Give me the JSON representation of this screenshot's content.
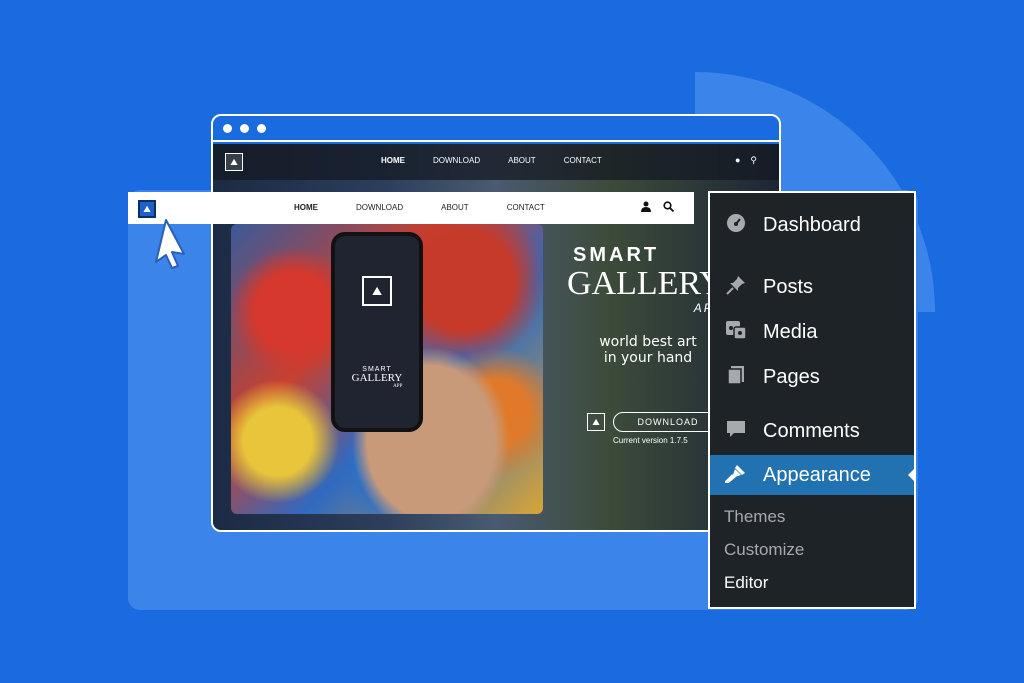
{
  "colors": {
    "background": "#1a6be0",
    "panel": "#3b84ea",
    "wp_menu_bg": "#1d2327",
    "wp_active": "#2271b1"
  },
  "site": {
    "nav": {
      "links": [
        "HOME",
        "DOWNLOAD",
        "ABOUT",
        "CONTACT"
      ],
      "icons": [
        "user-icon",
        "search-icon"
      ]
    },
    "hero": {
      "brand_smart": "SMART",
      "brand_gallery": "GALLERY",
      "brand_app": "APP",
      "tagline": "world best art in your hand",
      "download_label": "DOWNLOAD",
      "version": "Current version 1.7.5"
    },
    "phone": {
      "brand_smart": "SMART",
      "brand_gallery": "GALLERY",
      "brand_app": "APP"
    }
  },
  "wp_menu": {
    "items": [
      {
        "label": "Dashboard",
        "icon": "dashboard-icon"
      },
      {
        "label": "Posts",
        "icon": "pin-icon"
      },
      {
        "label": "Media",
        "icon": "media-icon"
      },
      {
        "label": "Pages",
        "icon": "pages-icon"
      },
      {
        "label": "Comments",
        "icon": "comment-icon"
      },
      {
        "label": "Appearance",
        "icon": "brush-icon",
        "active": true
      }
    ],
    "submenu": [
      {
        "label": "Themes"
      },
      {
        "label": "Customize"
      },
      {
        "label": "Editor",
        "current": true
      }
    ]
  }
}
